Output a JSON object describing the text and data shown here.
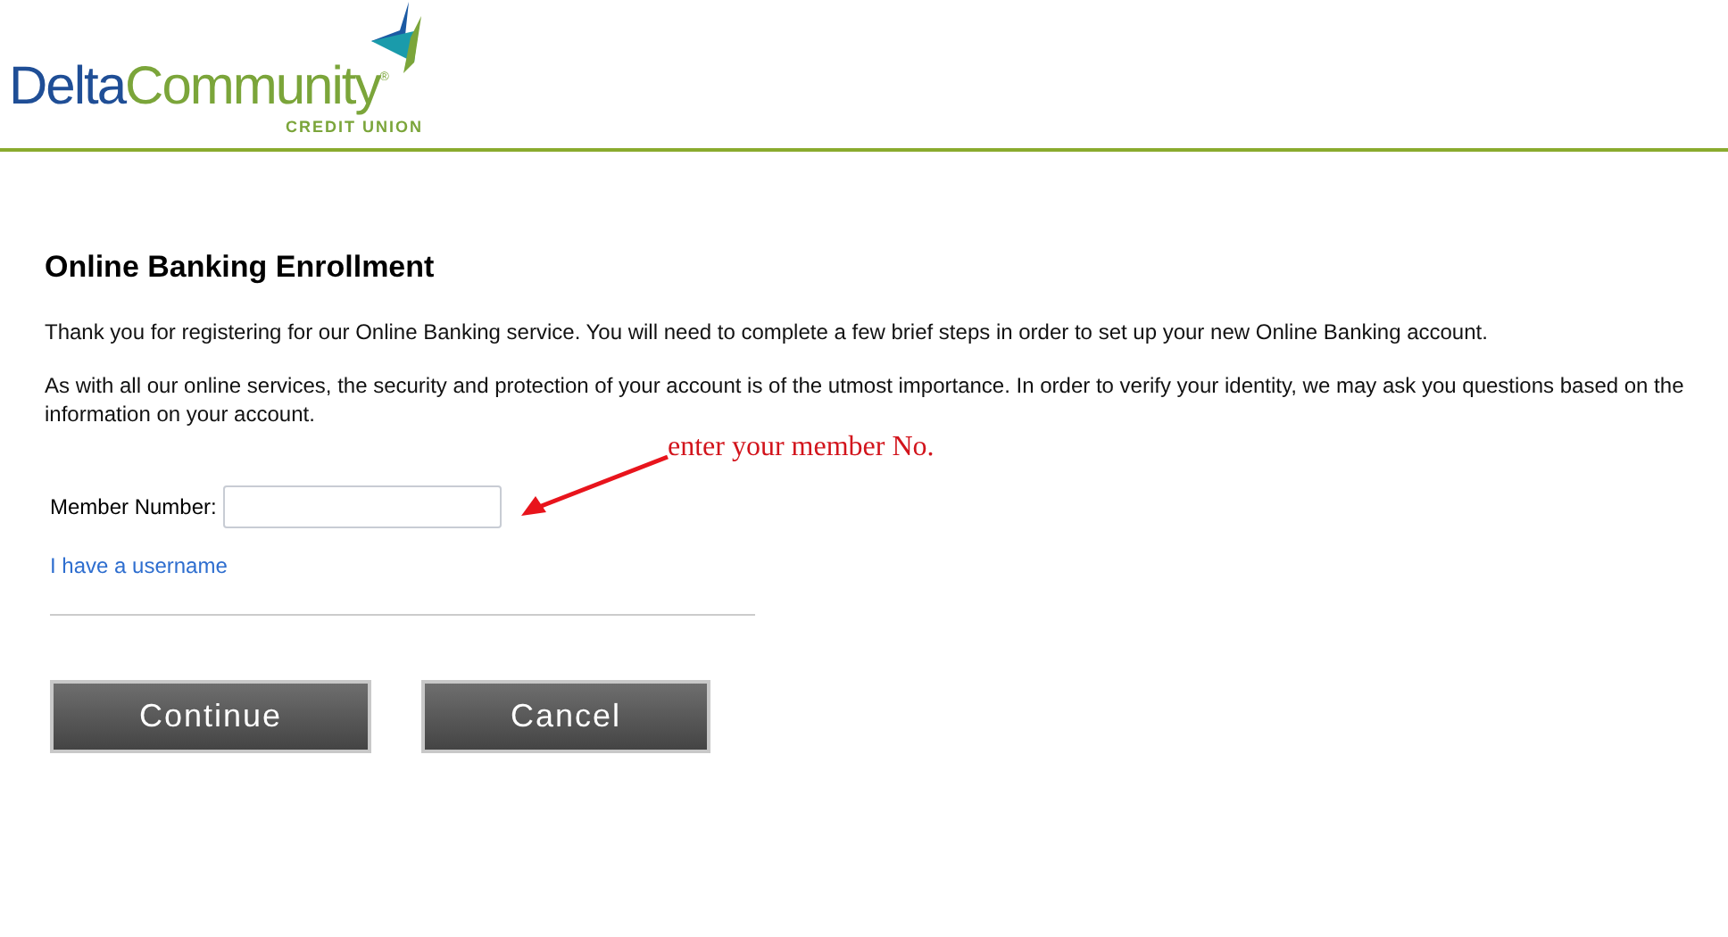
{
  "logo": {
    "name_first": "Delta",
    "name_second": "Community",
    "registered": "®",
    "tagline": "CREDIT UNION"
  },
  "heading": "Online Banking Enrollment",
  "paragraphs": [
    "Thank you for registering for our Online Banking service. You will need to complete a few brief steps in order to set up your new Online Banking account.",
    "As with all our online services, the security and protection of your account is of the utmost importance. In order to verify your identity, we may ask you questions based on the information on your account."
  ],
  "member_field": {
    "label": "Member Number:"
  },
  "annotation": "enter your member No.",
  "username_link": "I have a username",
  "buttons": [
    "Continue",
    "Cancel"
  ]
}
